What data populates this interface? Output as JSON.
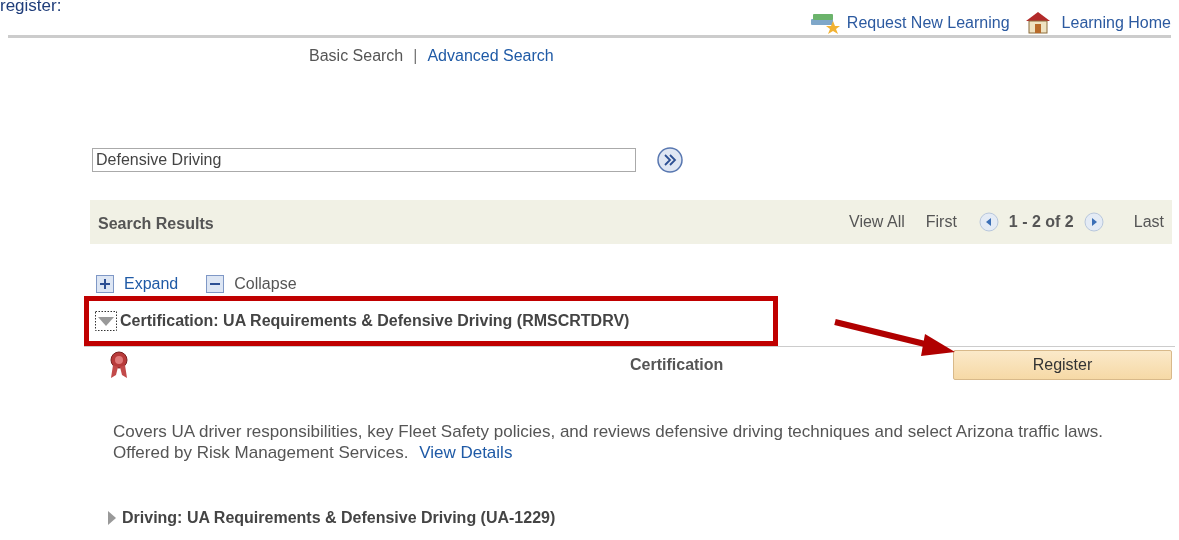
{
  "intro_text": "register:",
  "header_links": [
    {
      "label": "Request New Learning",
      "kind": "books"
    },
    {
      "label": "Learning Home",
      "kind": "house"
    }
  ],
  "search_modes_separator": "|",
  "search_modes": [
    {
      "label": "Basic Search",
      "selected": true
    },
    {
      "label": "Advanced Search",
      "selected": false
    }
  ],
  "search": {
    "value": "Defensive Driving"
  },
  "results_bar": {
    "title": "Search Results",
    "view_all": "View All",
    "first": "First",
    "range": "1 - 2 of 2",
    "last": "Last"
  },
  "tree_controls": [
    {
      "label": "Expand",
      "kind": "plus"
    },
    {
      "label": "Collapse",
      "kind": "minus"
    }
  ],
  "results": [
    {
      "title": "Certification: UA Requirements & Defensive Driving (RMSCRTDRV)",
      "expanded": true,
      "highlighted": true,
      "type": "Certification",
      "button": "Register",
      "description": "Covers UA driver responsibilities, key Fleet Safety policies, and reviews defensive driving techniques and select Arizona traffic laws. Offered by Risk Management Services.",
      "link": "View Details"
    },
    {
      "title": "Driving: UA Requirements & Defensive Driving (UA-1229)",
      "expanded": false,
      "highlighted": false
    }
  ],
  "annotation": {
    "kind": "arrow"
  }
}
